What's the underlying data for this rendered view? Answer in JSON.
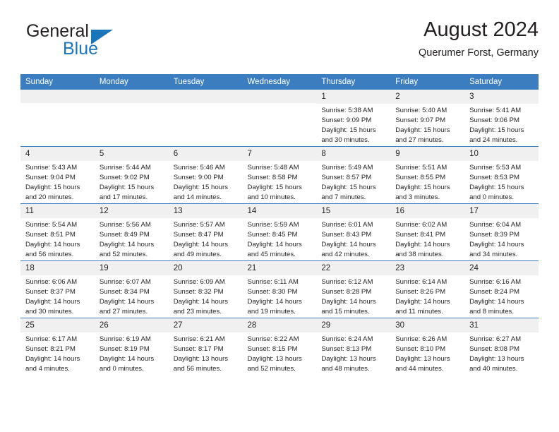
{
  "brand": {
    "name_part1": "General",
    "name_part2": "Blue",
    "logo_icon": "triangle-logo-icon"
  },
  "header": {
    "title": "August 2024",
    "location": "Querumer Forst, Germany"
  },
  "calendar": {
    "weekday_headers": [
      "Sunday",
      "Monday",
      "Tuesday",
      "Wednesday",
      "Thursday",
      "Friday",
      "Saturday"
    ],
    "accent_color": "#3b7dbf",
    "daynum_band_color": "#f0f0f0",
    "weeks": [
      [
        {
          "day": "",
          "empty": true
        },
        {
          "day": "",
          "empty": true
        },
        {
          "day": "",
          "empty": true
        },
        {
          "day": "",
          "empty": true
        },
        {
          "day": "1",
          "sunrise": "Sunrise: 5:38 AM",
          "sunset": "Sunset: 9:09 PM",
          "daylight1": "Daylight: 15 hours",
          "daylight2": "and 30 minutes."
        },
        {
          "day": "2",
          "sunrise": "Sunrise: 5:40 AM",
          "sunset": "Sunset: 9:07 PM",
          "daylight1": "Daylight: 15 hours",
          "daylight2": "and 27 minutes."
        },
        {
          "day": "3",
          "sunrise": "Sunrise: 5:41 AM",
          "sunset": "Sunset: 9:06 PM",
          "daylight1": "Daylight: 15 hours",
          "daylight2": "and 24 minutes."
        }
      ],
      [
        {
          "day": "4",
          "sunrise": "Sunrise: 5:43 AM",
          "sunset": "Sunset: 9:04 PM",
          "daylight1": "Daylight: 15 hours",
          "daylight2": "and 20 minutes."
        },
        {
          "day": "5",
          "sunrise": "Sunrise: 5:44 AM",
          "sunset": "Sunset: 9:02 PM",
          "daylight1": "Daylight: 15 hours",
          "daylight2": "and 17 minutes."
        },
        {
          "day": "6",
          "sunrise": "Sunrise: 5:46 AM",
          "sunset": "Sunset: 9:00 PM",
          "daylight1": "Daylight: 15 hours",
          "daylight2": "and 14 minutes."
        },
        {
          "day": "7",
          "sunrise": "Sunrise: 5:48 AM",
          "sunset": "Sunset: 8:58 PM",
          "daylight1": "Daylight: 15 hours",
          "daylight2": "and 10 minutes."
        },
        {
          "day": "8",
          "sunrise": "Sunrise: 5:49 AM",
          "sunset": "Sunset: 8:57 PM",
          "daylight1": "Daylight: 15 hours",
          "daylight2": "and 7 minutes."
        },
        {
          "day": "9",
          "sunrise": "Sunrise: 5:51 AM",
          "sunset": "Sunset: 8:55 PM",
          "daylight1": "Daylight: 15 hours",
          "daylight2": "and 3 minutes."
        },
        {
          "day": "10",
          "sunrise": "Sunrise: 5:53 AM",
          "sunset": "Sunset: 8:53 PM",
          "daylight1": "Daylight: 15 hours",
          "daylight2": "and 0 minutes."
        }
      ],
      [
        {
          "day": "11",
          "sunrise": "Sunrise: 5:54 AM",
          "sunset": "Sunset: 8:51 PM",
          "daylight1": "Daylight: 14 hours",
          "daylight2": "and 56 minutes."
        },
        {
          "day": "12",
          "sunrise": "Sunrise: 5:56 AM",
          "sunset": "Sunset: 8:49 PM",
          "daylight1": "Daylight: 14 hours",
          "daylight2": "and 52 minutes."
        },
        {
          "day": "13",
          "sunrise": "Sunrise: 5:57 AM",
          "sunset": "Sunset: 8:47 PM",
          "daylight1": "Daylight: 14 hours",
          "daylight2": "and 49 minutes."
        },
        {
          "day": "14",
          "sunrise": "Sunrise: 5:59 AM",
          "sunset": "Sunset: 8:45 PM",
          "daylight1": "Daylight: 14 hours",
          "daylight2": "and 45 minutes."
        },
        {
          "day": "15",
          "sunrise": "Sunrise: 6:01 AM",
          "sunset": "Sunset: 8:43 PM",
          "daylight1": "Daylight: 14 hours",
          "daylight2": "and 42 minutes."
        },
        {
          "day": "16",
          "sunrise": "Sunrise: 6:02 AM",
          "sunset": "Sunset: 8:41 PM",
          "daylight1": "Daylight: 14 hours",
          "daylight2": "and 38 minutes."
        },
        {
          "day": "17",
          "sunrise": "Sunrise: 6:04 AM",
          "sunset": "Sunset: 8:39 PM",
          "daylight1": "Daylight: 14 hours",
          "daylight2": "and 34 minutes."
        }
      ],
      [
        {
          "day": "18",
          "sunrise": "Sunrise: 6:06 AM",
          "sunset": "Sunset: 8:37 PM",
          "daylight1": "Daylight: 14 hours",
          "daylight2": "and 30 minutes."
        },
        {
          "day": "19",
          "sunrise": "Sunrise: 6:07 AM",
          "sunset": "Sunset: 8:34 PM",
          "daylight1": "Daylight: 14 hours",
          "daylight2": "and 27 minutes."
        },
        {
          "day": "20",
          "sunrise": "Sunrise: 6:09 AM",
          "sunset": "Sunset: 8:32 PM",
          "daylight1": "Daylight: 14 hours",
          "daylight2": "and 23 minutes."
        },
        {
          "day": "21",
          "sunrise": "Sunrise: 6:11 AM",
          "sunset": "Sunset: 8:30 PM",
          "daylight1": "Daylight: 14 hours",
          "daylight2": "and 19 minutes."
        },
        {
          "day": "22",
          "sunrise": "Sunrise: 6:12 AM",
          "sunset": "Sunset: 8:28 PM",
          "daylight1": "Daylight: 14 hours",
          "daylight2": "and 15 minutes."
        },
        {
          "day": "23",
          "sunrise": "Sunrise: 6:14 AM",
          "sunset": "Sunset: 8:26 PM",
          "daylight1": "Daylight: 14 hours",
          "daylight2": "and 11 minutes."
        },
        {
          "day": "24",
          "sunrise": "Sunrise: 6:16 AM",
          "sunset": "Sunset: 8:24 PM",
          "daylight1": "Daylight: 14 hours",
          "daylight2": "and 8 minutes."
        }
      ],
      [
        {
          "day": "25",
          "sunrise": "Sunrise: 6:17 AM",
          "sunset": "Sunset: 8:21 PM",
          "daylight1": "Daylight: 14 hours",
          "daylight2": "and 4 minutes."
        },
        {
          "day": "26",
          "sunrise": "Sunrise: 6:19 AM",
          "sunset": "Sunset: 8:19 PM",
          "daylight1": "Daylight: 14 hours",
          "daylight2": "and 0 minutes."
        },
        {
          "day": "27",
          "sunrise": "Sunrise: 6:21 AM",
          "sunset": "Sunset: 8:17 PM",
          "daylight1": "Daylight: 13 hours",
          "daylight2": "and 56 minutes."
        },
        {
          "day": "28",
          "sunrise": "Sunrise: 6:22 AM",
          "sunset": "Sunset: 8:15 PM",
          "daylight1": "Daylight: 13 hours",
          "daylight2": "and 52 minutes."
        },
        {
          "day": "29",
          "sunrise": "Sunrise: 6:24 AM",
          "sunset": "Sunset: 8:13 PM",
          "daylight1": "Daylight: 13 hours",
          "daylight2": "and 48 minutes."
        },
        {
          "day": "30",
          "sunrise": "Sunrise: 6:26 AM",
          "sunset": "Sunset: 8:10 PM",
          "daylight1": "Daylight: 13 hours",
          "daylight2": "and 44 minutes."
        },
        {
          "day": "31",
          "sunrise": "Sunrise: 6:27 AM",
          "sunset": "Sunset: 8:08 PM",
          "daylight1": "Daylight: 13 hours",
          "daylight2": "and 40 minutes."
        }
      ]
    ]
  }
}
